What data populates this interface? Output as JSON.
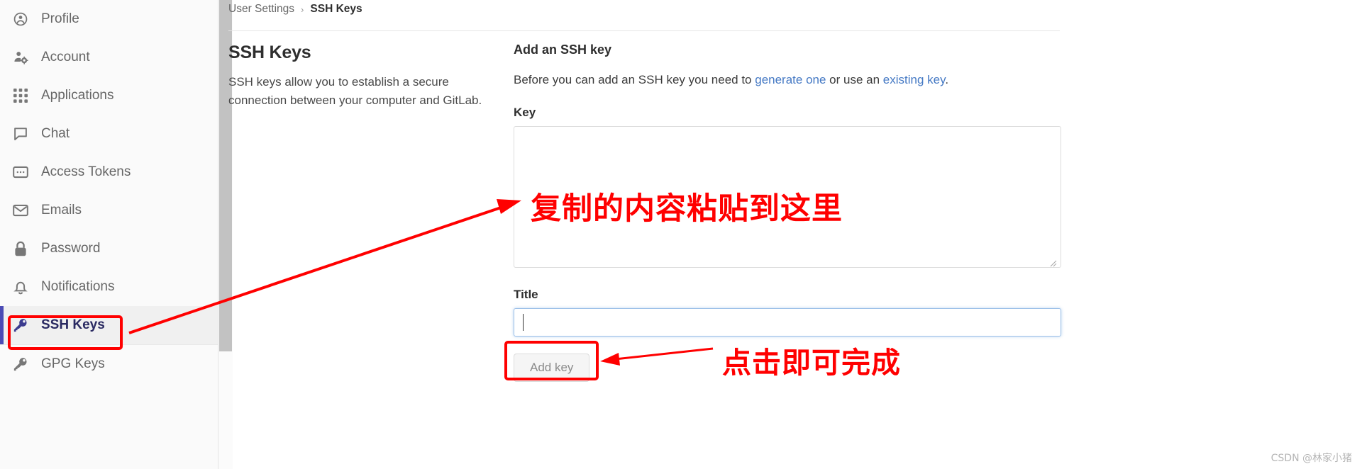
{
  "sidebar": {
    "items": [
      {
        "label": "Profile",
        "icon": "user-circle-icon",
        "active": false
      },
      {
        "label": "Account",
        "icon": "account-gear-icon",
        "active": false
      },
      {
        "label": "Applications",
        "icon": "grid-apps-icon",
        "active": false
      },
      {
        "label": "Chat",
        "icon": "chat-bubble-icon",
        "active": false
      },
      {
        "label": "Access Tokens",
        "icon": "token-card-icon",
        "active": false
      },
      {
        "label": "Emails",
        "icon": "envelope-icon",
        "active": false
      },
      {
        "label": "Password",
        "icon": "lock-icon",
        "active": false
      },
      {
        "label": "Notifications",
        "icon": "bell-icon",
        "active": false
      },
      {
        "label": "SSH Keys",
        "icon": "key-icon",
        "active": true
      },
      {
        "label": "GPG Keys",
        "icon": "key-icon",
        "active": false
      }
    ]
  },
  "breadcrumb": {
    "parent": "User Settings",
    "separator": "›",
    "current": "SSH Keys"
  },
  "page": {
    "title": "SSH Keys",
    "description": "SSH keys allow you to establish a secure connection between your computer and GitLab."
  },
  "form": {
    "heading": "Add an SSH key",
    "help_prefix": "Before you can add an SSH key you need to ",
    "help_link_1": "generate one",
    "help_middle": " or use an ",
    "help_link_2": "existing key",
    "help_suffix": ".",
    "key_label": "Key",
    "key_value": "",
    "key_placeholder": "",
    "title_label": "Title",
    "title_value": "",
    "title_placeholder": "",
    "submit_label": "Add key"
  },
  "annotations": {
    "paste_here": "复制的内容粘贴到这里",
    "click_to_finish": "点击即可完成"
  },
  "watermark": "CSDN @林家小猪",
  "colors": {
    "annotation_red": "#ff0000",
    "link_blue": "#4579c4",
    "active_nav": "#292961",
    "active_bar": "#4b4bb5"
  }
}
